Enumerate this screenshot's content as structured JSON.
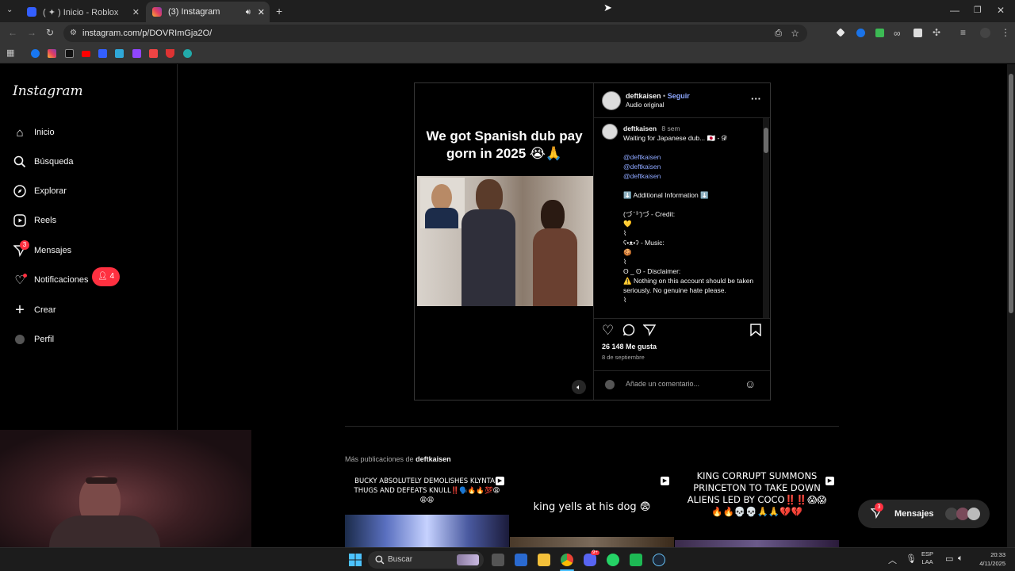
{
  "browser": {
    "tabs": [
      {
        "label": "( ✦ ) Inicio - Roblox"
      },
      {
        "label": "(3) Instagram"
      }
    ],
    "url": "instagram.com/p/DOVRImGja2O/"
  },
  "sidebar": {
    "logo": "Instagram",
    "items": [
      {
        "label": "Inicio"
      },
      {
        "label": "Búsqueda"
      },
      {
        "label": "Explorar"
      },
      {
        "label": "Reels"
      },
      {
        "label": "Mensajes",
        "badge": "3"
      },
      {
        "label": "Notificaciones",
        "badge": "4"
      },
      {
        "label": "Crear"
      },
      {
        "label": "Perfil"
      }
    ]
  },
  "post": {
    "media_caption": "We got Spanish dub pay gorn in 2025 😭🙏",
    "author": "deftkaisen",
    "follow": "Seguir",
    "dot": "•",
    "audio": "Audio original",
    "comment_author": "deftkaisen",
    "comment_age": "8 sem",
    "comment_line1": "Waiting for Japanese dub... 🇯🇵 - 𝓓",
    "mentions": [
      "@deftkaisen",
      "@deftkaisen",
      "@deftkaisen"
    ],
    "additional": "⬇️ Additional Information ⬇️",
    "credit": "(づ ̄ ³ ̄)づ - Credit:",
    "credit_emoji": "💛",
    "bar1": "⌇",
    "music": "ʕ•ᴥ•ʔ - Music:",
    "music_emoji": "🍪",
    "bar2": "⌇",
    "disclaimer": "ʘ _ ʘ - Disclaimer:",
    "disclaimer_text": "⚠️ Nothing on this account should be taken seriously. No genuine hate please.",
    "bar3": "⌇",
    "likes": "26 148 Me gusta",
    "date": "8 de septiembre",
    "comment_placeholder": "Añade un comentario..."
  },
  "more": {
    "label": "Más publicaciones de",
    "user": "deftkaisen",
    "thumbs": [
      {
        "text": "BUCKY ABSOLUTELY DEMOLISHES KLYNTAR THUGS AND DEFEATS KNULL‼️🗣️🔥🔥💯😩😩😩"
      },
      {
        "text": "king yells at his dog 😨"
      },
      {
        "text": "KING CORRUPT SUMMONS PRINCETON TO TAKE DOWN ALIENS LED BY COCO‼️‼️😱😱🔥🔥💀💀🙏🙏💔💔"
      }
    ]
  },
  "messages_pill": {
    "label": "Mensajes",
    "badge": "3"
  },
  "taskbar": {
    "search": "Buscar",
    "lang_top": "ESP",
    "lang_bottom": "LAA",
    "time": "20:33",
    "date": "4/11/2025",
    "discord_badge": "9+"
  },
  "colors": {
    "accent": "#0095f6",
    "badge": "#ff3040",
    "link": "#8da7ff",
    "bg": "#000000"
  }
}
